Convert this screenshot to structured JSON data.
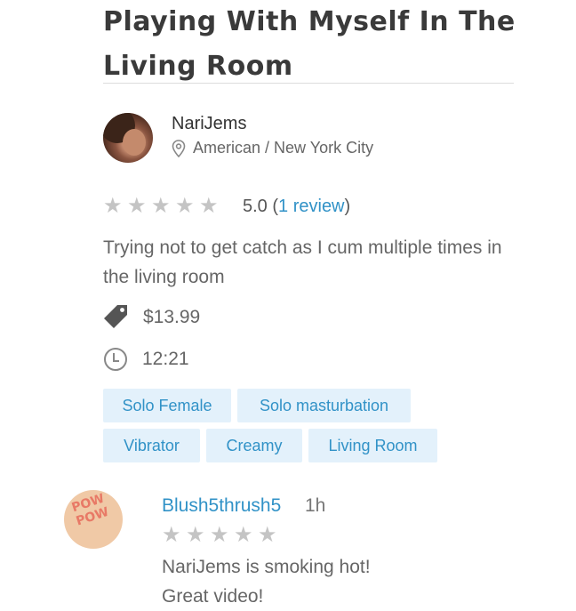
{
  "video": {
    "title": "Playing With Myself In The Living Room",
    "author": "NariJems",
    "location": "American / New York City",
    "rating_value": "5.0",
    "rating_open": " (",
    "rating_link": "1 review",
    "rating_close": ")",
    "stars": 5,
    "description": "Trying not to get catch as I cum multiple times in the living room",
    "price": "$13.99",
    "duration": "12:21",
    "tags": [
      "Solo Female",
      "Solo masturbation",
      "Vibrator",
      "Creamy",
      "Living Room"
    ]
  },
  "comment": {
    "author": "Blush5thrush5",
    "time": "1h",
    "avatar_text": "POW POW",
    "stars": 5,
    "line1": "NariJems is smoking hot!",
    "line2": "Great video!"
  },
  "colors": {
    "accent": "#3192c7",
    "tag_bg": "#e3f1fb",
    "star": "#c4c4c4"
  },
  "icons": {
    "location": "map-pin-icon",
    "price": "price-tag-icon",
    "duration": "clock-icon",
    "star": "star-icon"
  }
}
